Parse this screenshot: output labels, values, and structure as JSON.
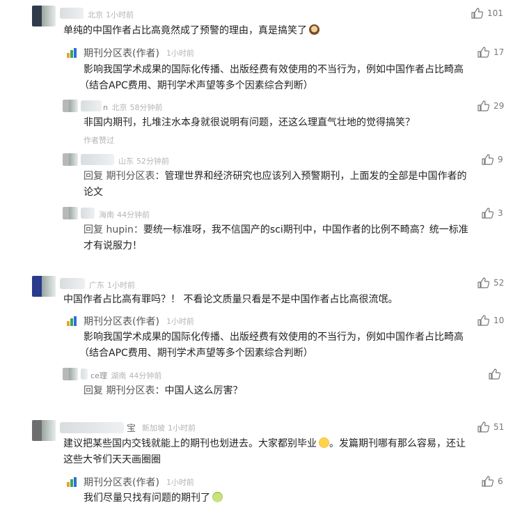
{
  "brand": {
    "logo_colors": [
      "#e6a42b",
      "#3aa45a",
      "#2f6fd6"
    ]
  },
  "comments": [
    {
      "region": "北京",
      "time": "1小时前",
      "likes": "101",
      "text": "单纯的中国作者占比高竟然成了预警的理由，真是搞笑了",
      "replies": [
        {
          "author": "期刊分区表(作者)",
          "time": "1小时前",
          "likes": "17",
          "text1": "影响我国学术成果的国际化传播、出版经费有效使用的不当行为，例如中国作者占比畸高",
          "text2": "（结合APC费用、期刊学术声望等多个因素综合判断）"
        },
        {
          "user": "n",
          "region": "北京",
          "time": "58分钟前",
          "likes": "29",
          "text": "非国内期刊，扎堆注水本身就很说明有问题，还这么理直气壮地的觉得搞笑？",
          "note": "作者赞过"
        },
        {
          "region": "山东",
          "time": "52分钟前",
          "likes": "9",
          "prefix": "回复 期刊分区表：",
          "text1": "管理世界和经济研究也应该列入预警期刊，上面发的全部是中国作者的",
          "text2": "论文"
        },
        {
          "region": "海南",
          "time": "44分钟前",
          "likes": "3",
          "prefix": "回复 hupin：",
          "text1": "要统一标准呀，我不信国产的sci期刊中，中国作者的比例不畸高？统一标准",
          "text2": "才有说服力！"
        }
      ]
    },
    {
      "region": "广东",
      "time": "1小时前",
      "likes": "52",
      "text": "中国作者占比高有罪吗？！ 不看论文质量只看是不是中国作者占比高很流氓。",
      "replies": [
        {
          "author": "期刊分区表(作者)",
          "time": "1小时前",
          "likes": "10",
          "text1": "影响我国学术成果的国际化传播、出版经费有效使用的不当行为，例如中国作者占比畸高",
          "text2": "（结合APC费用、期刊学术声望等多个因素综合判断）"
        },
        {
          "user": "ce理",
          "region": "湖南",
          "time": "44分钟前",
          "likes": "",
          "prefix": "回复 期刊分区表：",
          "text": "中国人这么厉害？"
        }
      ]
    },
    {
      "user": "宝",
      "region": "新加坡",
      "time": "1小时前",
      "likes": "51",
      "text1": "建议把某些国内交钱就能上的期刊也划进去。大家都别毕业",
      "text1b": "。发篇期刊哪有那么容易，还让",
      "text2": "这些大爷们天天画圈圈",
      "replies": [
        {
          "author": "期刊分区表(作者)",
          "time": "1小时前",
          "likes": "6",
          "text": "我们尽量只找有问题的期刊了"
        }
      ]
    }
  ]
}
